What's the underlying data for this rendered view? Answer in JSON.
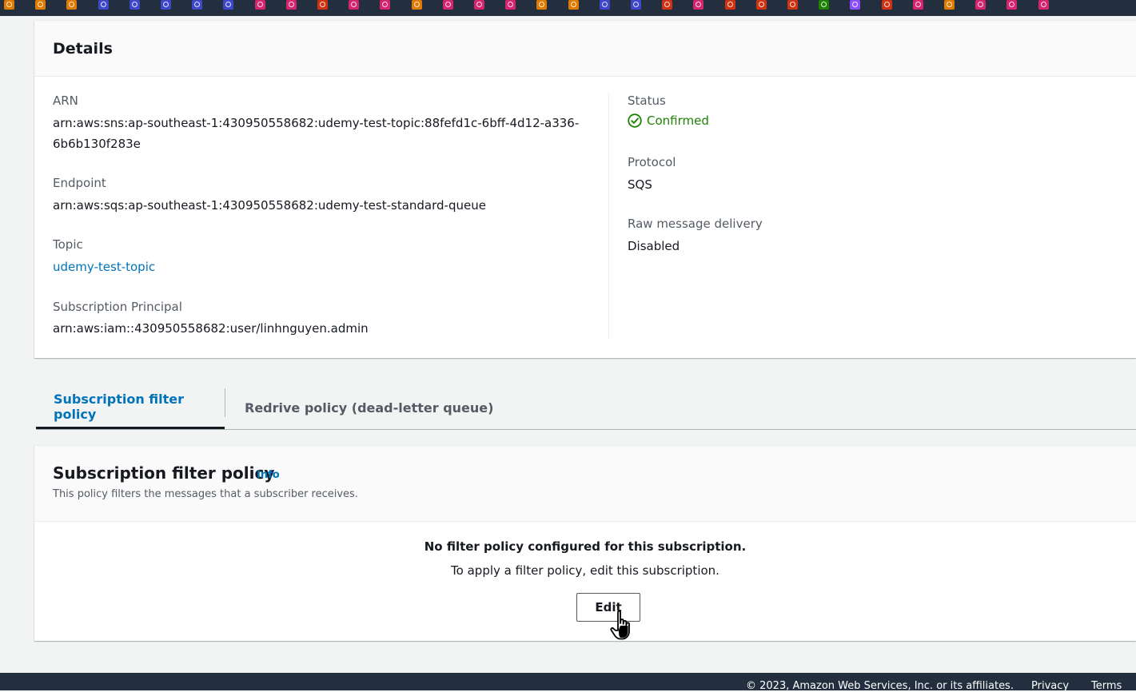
{
  "favorites_bar": {
    "icons": [
      {
        "name": "service-icon",
        "color": "#e07b00"
      },
      {
        "name": "service-icon",
        "color": "#e07b00"
      },
      {
        "name": "service-icon",
        "color": "#e07b00"
      },
      {
        "name": "service-icon",
        "color": "#3f48cc"
      },
      {
        "name": "service-icon",
        "color": "#3f48cc"
      },
      {
        "name": "service-icon",
        "color": "#3f48cc"
      },
      {
        "name": "service-icon",
        "color": "#3f48cc"
      },
      {
        "name": "service-icon",
        "color": "#3f48cc"
      },
      {
        "name": "service-icon",
        "color": "#d6246e"
      },
      {
        "name": "service-icon",
        "color": "#d6246e"
      },
      {
        "name": "service-icon",
        "color": "#d13212"
      },
      {
        "name": "service-icon",
        "color": "#d6246e"
      },
      {
        "name": "service-icon",
        "color": "#d6246e"
      },
      {
        "name": "service-icon",
        "color": "#e07b00"
      },
      {
        "name": "service-icon",
        "color": "#d6246e"
      },
      {
        "name": "service-icon",
        "color": "#d6246e"
      },
      {
        "name": "service-icon",
        "color": "#d6246e"
      },
      {
        "name": "service-icon",
        "color": "#e07b00"
      },
      {
        "name": "service-icon",
        "color": "#e07b00"
      },
      {
        "name": "service-icon",
        "color": "#3f48cc"
      },
      {
        "name": "service-icon",
        "color": "#3f48cc"
      },
      {
        "name": "service-icon",
        "color": "#d13212"
      },
      {
        "name": "service-icon",
        "color": "#d6246e"
      },
      {
        "name": "service-icon",
        "color": "#d13212"
      },
      {
        "name": "service-icon",
        "color": "#d13212"
      },
      {
        "name": "service-icon",
        "color": "#d13212"
      },
      {
        "name": "service-icon",
        "color": "#1d8102"
      },
      {
        "name": "service-icon",
        "color": "#8c4fff"
      },
      {
        "name": "service-icon",
        "color": "#d13212"
      },
      {
        "name": "service-icon",
        "color": "#d6246e"
      },
      {
        "name": "service-icon",
        "color": "#e07b00"
      },
      {
        "name": "service-icon",
        "color": "#d6246e"
      },
      {
        "name": "service-icon",
        "color": "#d6246e"
      },
      {
        "name": "service-icon",
        "color": "#d6246e"
      }
    ]
  },
  "details": {
    "title": "Details",
    "arn_label": "ARN",
    "arn_line1": "arn:aws:sns:ap-southeast-1:430950558682:udemy-test-topic:88fefd1c-6bff-4d12-a336-",
    "arn_line2": "6b6b130f283e",
    "endpoint_label": "Endpoint",
    "endpoint_value": "arn:aws:sqs:ap-southeast-1:430950558682:udemy-test-standard-queue",
    "topic_label": "Topic",
    "topic_value": "udemy-test-topic",
    "principal_label": "Subscription Principal",
    "principal_value": "arn:aws:iam::430950558682:user/linhnguyen.admin",
    "status_label": "Status",
    "status_value": "Confirmed",
    "status_color": "#1d8102",
    "protocol_label": "Protocol",
    "protocol_value": "SQS",
    "raw_label": "Raw message delivery",
    "raw_value": "Disabled"
  },
  "tabs": [
    {
      "label": "Subscription filter policy",
      "active": true
    },
    {
      "label": "Redrive policy (dead-letter queue)",
      "active": false
    }
  ],
  "filter_policy": {
    "title": "Subscription filter policy",
    "info_label": "Info",
    "description": "This policy filters the messages that a subscriber receives.",
    "empty_title": "No filter policy configured for this subscription.",
    "empty_subtitle": "To apply a filter policy, edit this subscription.",
    "edit_label": "Edit"
  },
  "footer": {
    "copyright": "© 2023, Amazon Web Services, Inc. or its affiliates.",
    "privacy": "Privacy",
    "terms": "Terms"
  },
  "colors": {
    "accent_link": "#0073bb",
    "header_dark": "#232f3e",
    "page_bg": "#f2f3f3"
  }
}
